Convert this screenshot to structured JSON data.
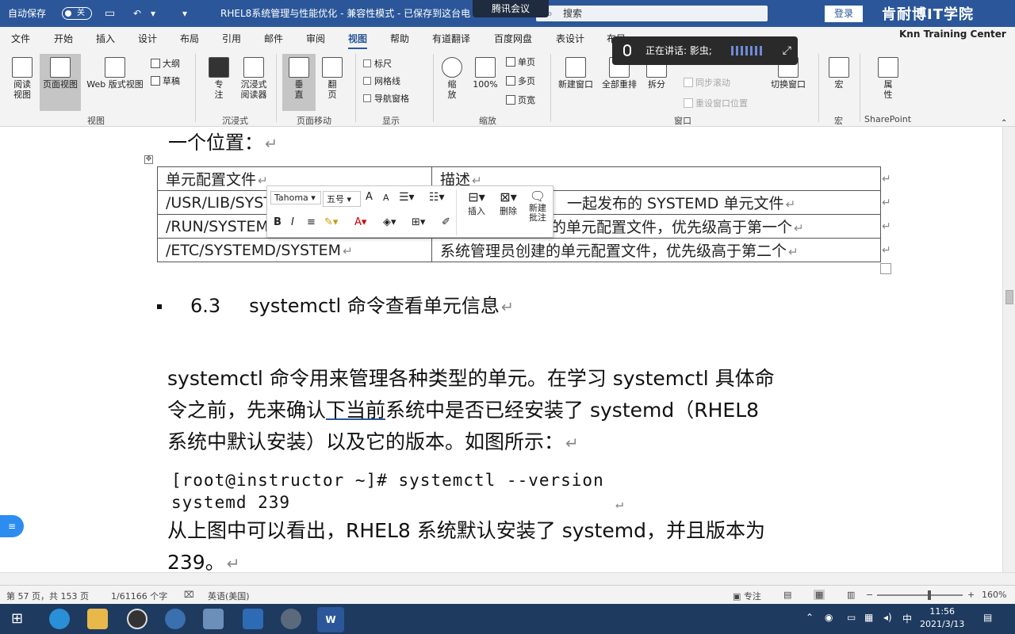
{
  "titlebar": {
    "autosave_label": "自动保存",
    "autosave_state": "关",
    "doc_title": "RHEL8系统管理与性能优化  -  兼容性模式  -  已保存到这台电",
    "meeting": "腾讯会议",
    "search_placeholder": "搜索",
    "login": "登录",
    "brand": "肯耐博IT学院",
    "brand_sub": "Knn Training Center"
  },
  "menu": {
    "tabs": [
      "文件",
      "开始",
      "插入",
      "设计",
      "布局",
      "引用",
      "邮件",
      "审阅",
      "视图",
      "帮助",
      "有道翻译",
      "百度网盘",
      "表设计",
      "布局"
    ],
    "active": "视图"
  },
  "ribbon": {
    "view_group": {
      "read": "阅读\n视图",
      "print": "页面视图",
      "web": "Web 版式视图",
      "outline": "大纲",
      "draft": "草稿",
      "label": "视图"
    },
    "immersive": {
      "focus": "专\n注",
      "reader": "沉浸式\n阅读器",
      "label": "沉浸式"
    },
    "page_move": {
      "vertical": "垂\n直",
      "flip": "翻\n页",
      "label": "页面移动"
    },
    "show": {
      "ruler": "标尺",
      "grid": "网格线",
      "nav": "导航窗格",
      "label": "显示"
    },
    "zoom": {
      "zoom": "缩\n放",
      "pct": "100%",
      "one": "单页",
      "multi": "多页",
      "width": "页宽",
      "label": "缩放"
    },
    "window": {
      "new": "新建窗口",
      "arrange": "全部重排",
      "split": "拆分",
      "sync": "同步滚动",
      "reset": "重设窗口位置",
      "switch": "切换窗口",
      "label": "窗口"
    },
    "macro": {
      "macro": "宏",
      "label": "宏"
    },
    "sharepoint": {
      "props": "属\n性",
      "label": "SharePoint"
    }
  },
  "speaking": {
    "text": "正在讲话: 影虫;"
  },
  "document": {
    "prev_line": "一个位置：",
    "table": {
      "header": [
        "单元配置文件",
        "描述"
      ],
      "rows": [
        [
          "/USR/LIB/SYSTE",
          "一起发布的 SYSTEMD 单元文件"
        ],
        [
          "/RUN/SYSTEMD",
          "的单元配置文件，优先级高于第一个"
        ],
        [
          "/ETC/SYSTEMD/SYSTEM",
          "系统管理员创建的单元配置文件，优先级高于第二个"
        ]
      ]
    },
    "heading_num": "6.3",
    "heading_text": "systemctl 命令查看单元信息",
    "para1_line1": "systemctl 命令用来管理各种类型的单元。在学习 systemctl 具体命",
    "para1_line2a": "令之前，先来确认",
    "para1_line2b": "下当前",
    "para1_line2c": "系统中是否已经安装了 systemd（RHEL8",
    "para1_line3": "系统中默认安装）以及它的版本。如图所示：",
    "code1": "[root@instructor ~]# systemctl --version",
    "code2": "systemd 239",
    "para2_line1": "从上图中可以看出，RHEL8 系统默认安装了 systemd，并且版本为",
    "para2_line2": "239。"
  },
  "mini_toolbar": {
    "font": "Tahoma",
    "size": "五号",
    "grow": "A",
    "shrink": "A",
    "bold": "B",
    "italic": "I",
    "insert": "插入",
    "delete": "删除",
    "new_comment": "新建\n批注"
  },
  "statusbar": {
    "page": "第 57 页，共 153 页",
    "words": "1/61166 个字",
    "lang": "英语(美国)",
    "focus": "专注",
    "zoom": "160%"
  },
  "taskbar": {
    "time": "11:56",
    "date": "2021/3/13",
    "ime": "中"
  },
  "colors": {
    "titlebar": "#2b579a",
    "taskbar": "#1e3a5f"
  }
}
